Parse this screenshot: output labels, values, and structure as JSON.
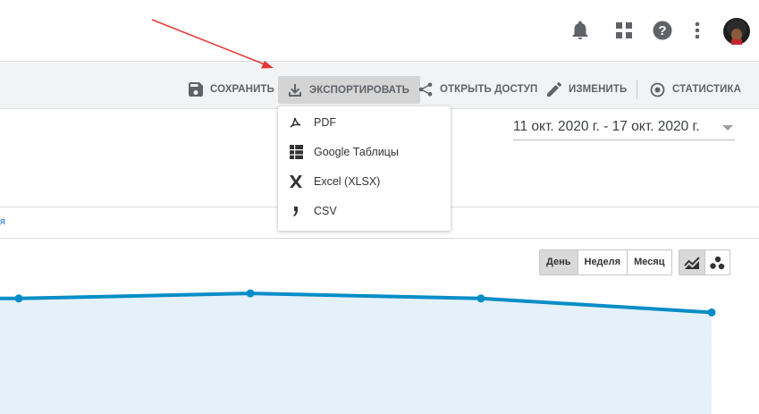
{
  "toolbar": {
    "save_label": "СОХРАНИТЬ",
    "export_label": "ЭКСПОРТИРОВАТЬ",
    "share_label": "ОТКРЫТЬ ДОСТУП",
    "edit_label": "ИЗМЕНИТЬ",
    "stats_label": "СТАТИСТИКА"
  },
  "export_menu": {
    "items": [
      {
        "label": "PDF",
        "icon": "pdf-icon"
      },
      {
        "label": "Google Таблицы",
        "icon": "sheets-icon"
      },
      {
        "label": "Excel (XLSX)",
        "icon": "excel-icon"
      },
      {
        "label": "CSV",
        "icon": "csv-icon"
      }
    ]
  },
  "date_range": "11 окт. 2020 г. - 17 окт. 2020 г.",
  "link_fragment": "я",
  "granularity": {
    "options": [
      "День",
      "Неделя",
      "Месяц"
    ],
    "selected": "День"
  },
  "chart_data": {
    "type": "area",
    "series": [
      {
        "values": [
          0.91,
          0.91,
          0.95,
          0.91,
          0.8
        ]
      }
    ],
    "color": "#058dc7",
    "fill": "#e5f1fa",
    "grid": true
  },
  "colors": {
    "accent_arrow": "#e53935",
    "toolbar_bg": "#f1f3f4",
    "line": "#058dc7"
  }
}
